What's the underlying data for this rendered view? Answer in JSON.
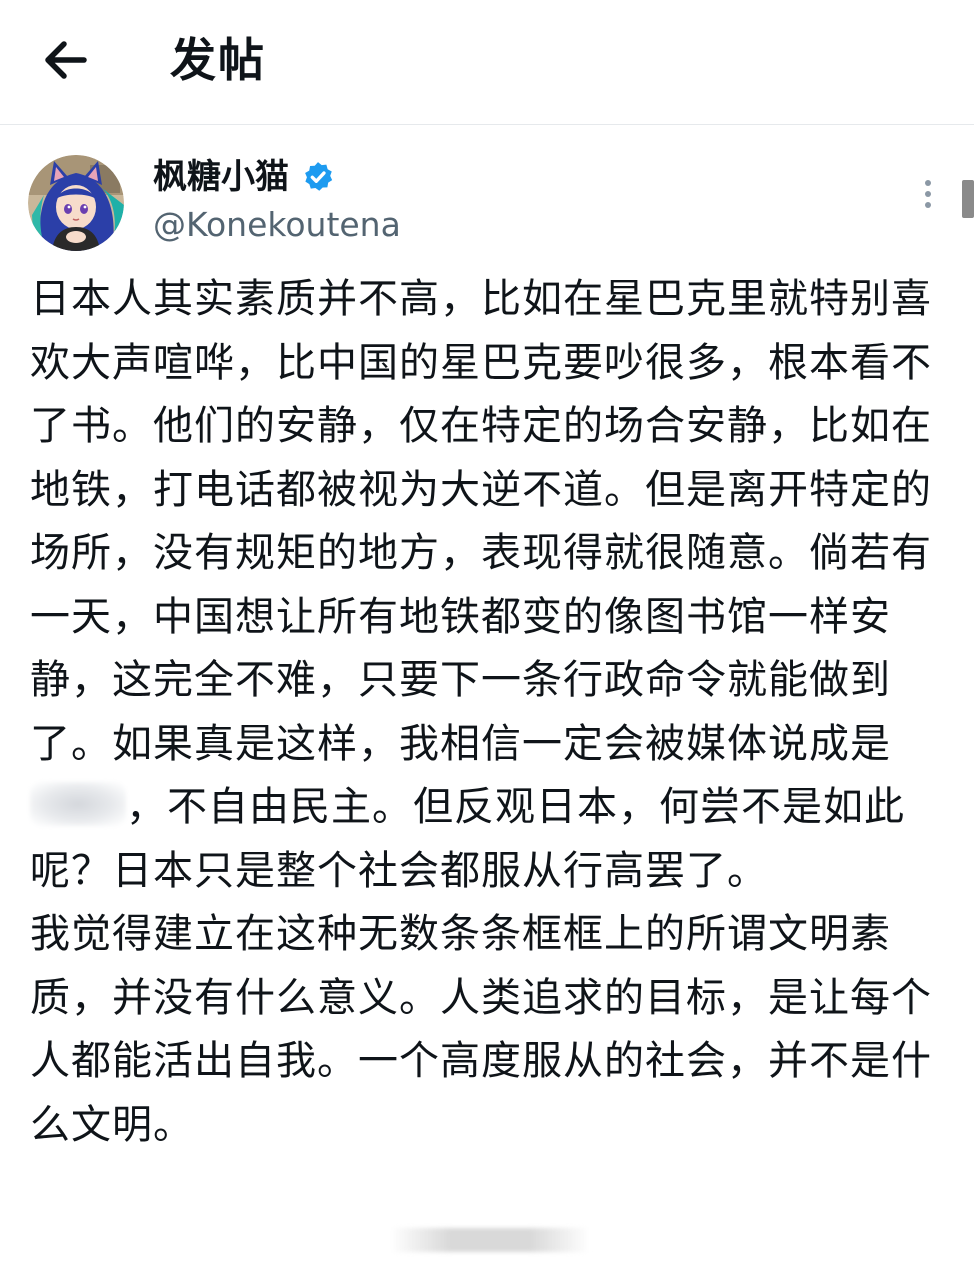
{
  "header": {
    "title": "发帖",
    "back_icon": "arrow-left-icon"
  },
  "author": {
    "display_name": "枫糖小猫",
    "handle": "@Konekoutena",
    "verified": true,
    "verified_color": "#1d9bf0",
    "avatar_icon": "avatar-anime-girl"
  },
  "menu": {
    "icon": "more-vertical-icon"
  },
  "post": {
    "p1_before_redaction": "日本人其实素质并不高，比如在星巴克里就特别喜欢大声喧哗，比中国的星巴克要吵很多，根本看不了书。他们的安静，仅在特定的场合安静，比如在地铁，打电话都被视为大逆不道。但是离开特定的场所，没有规矩的地方，表现得就很随意。倘若有一天，中国想让所有地铁都变的像图书馆一样安静，这完全不难，只要下一条行政命令就能做到了。如果真是这样，我相信一定会被媒体说成是",
    "p1_after_redaction": "，不自由民主。但反观日本，何尝不是如此呢？日本只是整个社会都服从行高罢了。",
    "p2": "我觉得建立在这种无数条条框框上的所谓文明素质，并没有什么意义。人类追求的目标，是让每个人都能活出自我。一个高度服从的社会，并不是什么文明。"
  },
  "colors": {
    "text": "#0f1419",
    "secondary": "#536471",
    "divider": "#e6e9ec"
  }
}
